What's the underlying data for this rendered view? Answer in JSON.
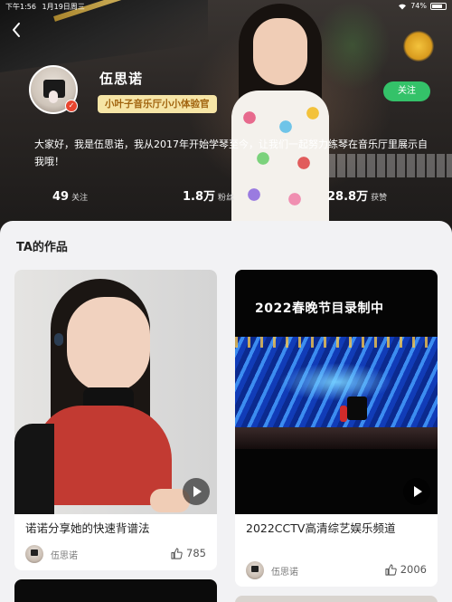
{
  "status_bar": {
    "time": "下午1:56",
    "date": "1月19日周三",
    "battery": "74%",
    "wifi_icon": "wifi-icon",
    "battery_icon": "battery-icon"
  },
  "header": {
    "back_icon": "chevron-left-icon",
    "name": "伍思诺",
    "role_tag": "小叶子音乐厅小小体验官",
    "follow_label": "关注",
    "follow_color": "#34c269",
    "tag_bg": "#f6e5a6",
    "tag_fg": "#a1640f",
    "bio": "大家好，我是伍思诺，我从2017年开始学琴至今，让我们一起努力练琴在音乐厅里展示自我哦！",
    "stats": [
      {
        "value": "49",
        "label": "关注"
      },
      {
        "value": "1.8万",
        "label": "粉丝"
      },
      {
        "value": "28.8万",
        "label": "获赞"
      }
    ]
  },
  "works": {
    "section_title": "TA的作品",
    "cards": [
      {
        "title": "诺诺分享她的快速背谱法",
        "author": "伍思诺",
        "likes": "785"
      },
      {
        "title": "2022CCTV高清综艺娱乐频道",
        "thumb_heading": "2022春晚节目录制中",
        "author": "伍思诺",
        "likes": "2006"
      }
    ]
  }
}
